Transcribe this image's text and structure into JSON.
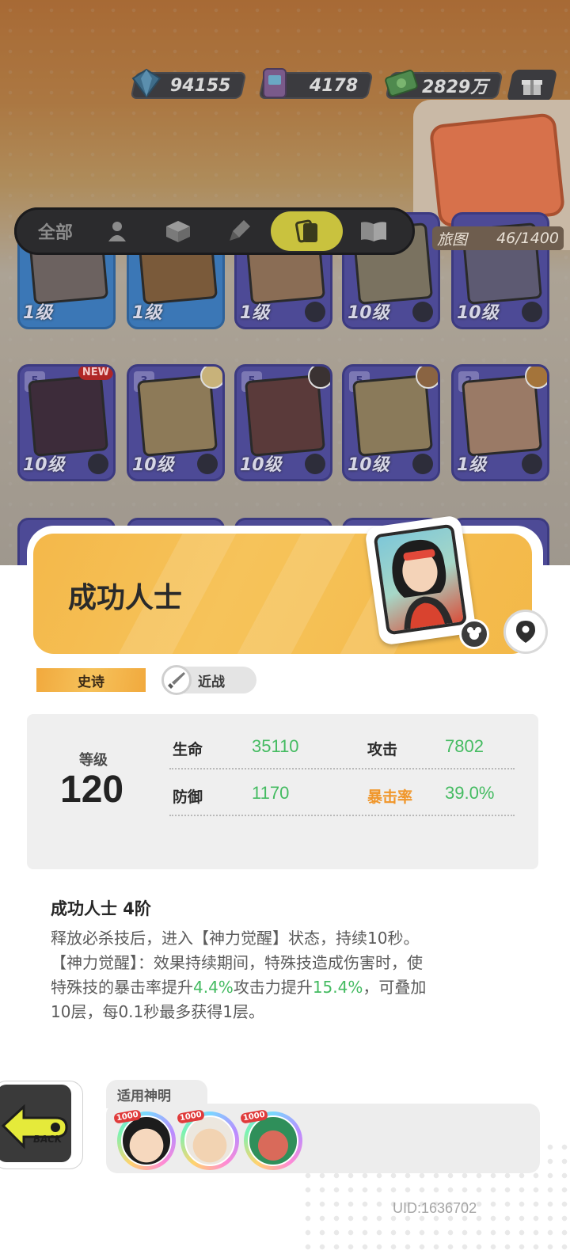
{
  "currency": {
    "diamonds": "94155",
    "tickets": "4178",
    "cash": "2829万"
  },
  "world_map": {
    "label": "旅图",
    "count": "46/1400"
  },
  "filter_tabs": {
    "all_label": "全部",
    "icons": [
      "person-icon",
      "box-icon",
      "rocket-icon",
      "cards-icon",
      "book-icon"
    ],
    "active_index": 3
  },
  "card_rows": [
    {
      "cards": [
        {
          "level": "1级",
          "color": "blue"
        },
        {
          "level": "1级",
          "color": "blue"
        },
        {
          "level": "1级",
          "color": "purple"
        },
        {
          "level": "10级",
          "color": "purple"
        },
        {
          "level": "10级",
          "color": "purple"
        }
      ]
    },
    {
      "cards": [
        {
          "level": "10级",
          "stack": "5",
          "new_tag": "NEW"
        },
        {
          "level": "10级",
          "stack": "3"
        },
        {
          "level": "10级",
          "stack": "5"
        },
        {
          "level": "10级",
          "stack": "5"
        },
        {
          "level": "1级",
          "stack": "2"
        }
      ]
    }
  ],
  "character": {
    "name": "成功人士",
    "rarity": "史诗",
    "attack_type": "近战"
  },
  "stats": {
    "level_label": "等级",
    "level_value": "120",
    "hp_label": "生命",
    "hp_value": "35110",
    "atk_label": "攻击",
    "atk_value": "7802",
    "def_label": "防御",
    "def_value": "1170",
    "crit_label": "暴击率",
    "crit_value": "39.0%"
  },
  "skill": {
    "title": "成功人士 4阶",
    "line1": "释放必杀技后，进入【神力觉醒】状态，持续10秒。",
    "line2": "【神力觉醒】：效果持续期间，特殊技造成伤害时，使",
    "line3_a": "特殊技的暴击率提升",
    "line3_hl1": "4.4%",
    "line3_b": "攻击力提升",
    "line3_hl2": "15.4%",
    "line3_c": "，可叠加",
    "line4": "10层，每0.1秒最多获得1层。"
  },
  "applicable_heroes": {
    "label": "适用神明",
    "heroes": [
      {
        "tag": "1000"
      },
      {
        "tag": "1000"
      },
      {
        "tag": "1000"
      }
    ]
  },
  "back_button": {
    "label": "BACK"
  },
  "uid": "UID:1636702",
  "colors": {
    "accent_yellow": "#f5be52",
    "stat_green": "#44bb61",
    "crit_orange": "#f0962a"
  }
}
